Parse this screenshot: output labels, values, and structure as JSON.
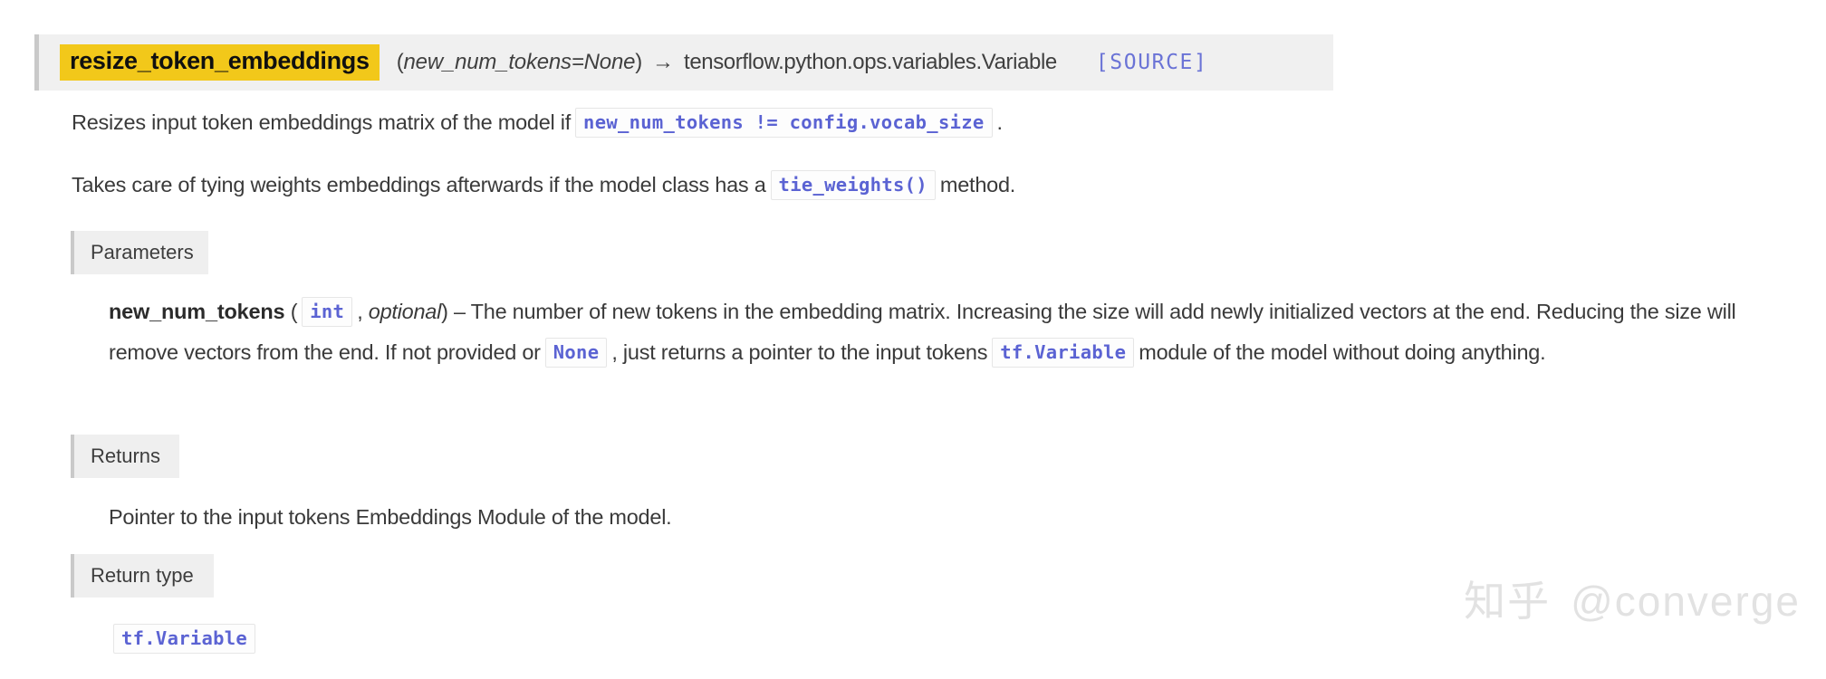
{
  "signature": {
    "name": "resize_token_embeddings",
    "params": "(new_num_tokens=None)",
    "params_italic": "new_num_tokens=None",
    "paren_open": "(",
    "paren_close": ")",
    "arrow": "→",
    "return_annotation": "tensorflow.python.ops.variables.Variable",
    "source_link": "[SOURCE]",
    "highlight_color": "#f2c81a",
    "link_color": "#6a73d6",
    "bar_background": "#f0f0f0"
  },
  "description": {
    "paragraph_1_before": "Resizes input token embeddings matrix of the model if",
    "paragraph_1_code": "new_num_tokens != config.vocab_size",
    "paragraph_1_after": ".",
    "paragraph_2_before": "Takes care of tying weights embeddings afterwards if the model class has a",
    "paragraph_2_code": "tie_weights()",
    "paragraph_2_after": "method."
  },
  "fields": {
    "parameters": {
      "label": "Parameters",
      "param_name": "new_num_tokens",
      "type_open": "(",
      "type_code": "int",
      "type_comma": ",",
      "type_optional": "optional",
      "type_close": ")",
      "dash": "–",
      "text_1": "The number of new tokens in the embedding matrix. Increasing the size will add newly initialized vectors at the end. Reducing the size will remove vectors from the end. If not provided or",
      "code_none": "None",
      "text_2": ", just returns a pointer to the input tokens",
      "code_tfvariable": "tf.Variable",
      "text_3": "module of the model without doing anything."
    },
    "returns": {
      "label": "Returns",
      "text": "Pointer to the input tokens Embeddings Module of the model."
    },
    "return_type": {
      "label": "Return type",
      "code": "tf.Variable"
    }
  },
  "watermark": {
    "logo": "知乎",
    "handle": "@converge"
  }
}
